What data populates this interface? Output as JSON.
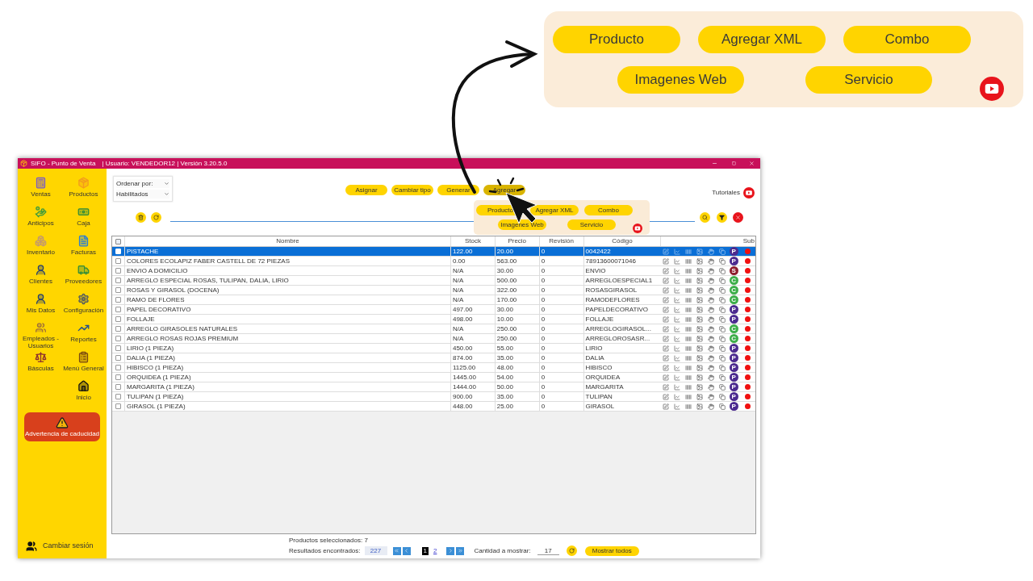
{
  "window": {
    "title": "SIFO - Punto de Venta",
    "info": "| Usuario: VENDEDOR12 | Versión 3.20.5.0"
  },
  "sidebar": {
    "items": [
      {
        "label": "Ventas",
        "kind": "register"
      },
      {
        "label": "Productos",
        "kind": "box"
      },
      {
        "label": "Anticipos",
        "kind": "money"
      },
      {
        "label": "Caja",
        "kind": "cash"
      },
      {
        "label": "Inventario",
        "kind": "boxes"
      },
      {
        "label": "Facturas",
        "kind": "document"
      },
      {
        "label": "Clientes",
        "kind": "person"
      },
      {
        "label": "Proveedores",
        "kind": "truck"
      },
      {
        "label": "Mis Datos",
        "kind": "person"
      },
      {
        "label": "Configuración",
        "kind": "gear"
      },
      {
        "label": "Empleados - Usuarios",
        "kind": "group"
      },
      {
        "label": "Reportes",
        "kind": "chart"
      },
      {
        "label": "Básculas",
        "kind": "scale"
      },
      {
        "label": "Menú General",
        "kind": "clipboard"
      },
      {
        "label": "Inicio",
        "kind": "home"
      }
    ],
    "warning": "Advertencia de caducidad",
    "session": "Cambiar sesión"
  },
  "filters": [
    "Ordenar por:",
    "Habilitados"
  ],
  "actions": [
    {
      "label": "Asignar",
      "selected": false
    },
    {
      "label": "Cambiar tipo",
      "selected": false
    },
    {
      "label": "Generar",
      "selected": false
    },
    {
      "label": "Agregar",
      "selected": true
    }
  ],
  "tutorials": "Tutoriales",
  "add_menu": [
    "Producto",
    "Agregar XML",
    "Combo",
    "Imagenes Web",
    "Servicio"
  ],
  "table": {
    "select_all": {
      "checked": false
    },
    "columns": [
      "Nombre",
      "Stock",
      "Precio",
      "Revisión",
      "Código"
    ],
    "sub_column": "Sub",
    "rows": [
      {
        "cells": [
          "PISTACHE",
          "122.00",
          "20.00",
          "0",
          "0042422"
        ],
        "badge": "P",
        "color": "#4b2a8f",
        "selected": true,
        "checked": false
      },
      {
        "cells": [
          "COLORES ECOLAPIZ FABER CASTELL DE 72 PIEZAS",
          "0.00",
          "563.00",
          "0",
          "78913600071046"
        ],
        "badge": "P",
        "color": "#4b2a8f",
        "selected": false,
        "checked": false
      },
      {
        "cells": [
          "ENVIO A DOMICILIO",
          "N/A",
          "30.00",
          "0",
          "ENVIO"
        ],
        "badge": "S",
        "color": "#8e1c2c",
        "selected": false,
        "checked": false
      },
      {
        "cells": [
          "ARREGLO ESPECIAL ROSAS, TULIPAN, DALIA, LIRIO",
          "N/A",
          "500.00",
          "0",
          "ARREGLOESPECIAL1"
        ],
        "badge": "C",
        "color": "#3dae49",
        "selected": false,
        "checked": false
      },
      {
        "cells": [
          "ROSAS Y GIRASOL (DOCENA)",
          "N/A",
          "322.00",
          "0",
          "ROSASGIRASOL"
        ],
        "badge": "C",
        "color": "#3dae49",
        "selected": false,
        "checked": false
      },
      {
        "cells": [
          "RAMO DE FLORES",
          "N/A",
          "170.00",
          "0",
          "RAMODEFLORES"
        ],
        "badge": "C",
        "color": "#3dae49",
        "selected": false,
        "checked": false
      },
      {
        "cells": [
          "PAPEL DECORATIVO",
          "497.00",
          "30.00",
          "0",
          "PAPELDECORATIVO"
        ],
        "badge": "P",
        "color": "#4b2a8f",
        "selected": false,
        "checked": false
      },
      {
        "cells": [
          "FOLLAJE",
          "498.00",
          "10.00",
          "0",
          "FOLLAJE"
        ],
        "badge": "P",
        "color": "#4b2a8f",
        "selected": false,
        "checked": false
      },
      {
        "cells": [
          "ARREGLO GIRASOLES NATURALES",
          "N/A",
          "250.00",
          "0",
          "ARREGLOGIRASOL..."
        ],
        "badge": "C",
        "color": "#3dae49",
        "selected": false,
        "checked": false
      },
      {
        "cells": [
          "ARREGLO ROSAS ROJAS PREMIUM",
          "N/A",
          "250.00",
          "0",
          "ARREGLOROSASR..."
        ],
        "badge": "C",
        "color": "#3dae49",
        "selected": false,
        "checked": false
      },
      {
        "cells": [
          "LIRIO (1 PIEZA)",
          "450.00",
          "55.00",
          "0",
          "LIRIO"
        ],
        "badge": "P",
        "color": "#4b2a8f",
        "selected": false,
        "checked": false
      },
      {
        "cells": [
          "DALIA (1 PIEZA)",
          "874.00",
          "35.00",
          "0",
          "DALIA"
        ],
        "badge": "P",
        "color": "#4b2a8f",
        "selected": false,
        "checked": false
      },
      {
        "cells": [
          "HIBISCO (1 PIEZA)",
          "1125.00",
          "48.00",
          "0",
          "HIBISCO"
        ],
        "badge": "P",
        "color": "#4b2a8f",
        "selected": false,
        "checked": false
      },
      {
        "cells": [
          "ORQUIDEA (1 PIEZA)",
          "1445.00",
          "54.00",
          "0",
          "ORQUIDEA"
        ],
        "badge": "P",
        "color": "#4b2a8f",
        "selected": false,
        "checked": false
      },
      {
        "cells": [
          "MARGARITA (1 PIEZA)",
          "1444.00",
          "50.00",
          "0",
          "MARGARITA"
        ],
        "badge": "P",
        "color": "#4b2a8f",
        "selected": false,
        "checked": false
      },
      {
        "cells": [
          "TULIPAN (1 PIEZA)",
          "900.00",
          "35.00",
          "0",
          "TULIPAN"
        ],
        "badge": "P",
        "color": "#4b2a8f",
        "selected": false,
        "checked": false
      },
      {
        "cells": [
          "GIRASOL (1 PIEZA)",
          "448.00",
          "25.00",
          "0",
          "GIRASOL"
        ],
        "badge": "P",
        "color": "#4b2a8f",
        "selected": false,
        "checked": false
      }
    ]
  },
  "footer": {
    "selected": "Productos seleccionados: 7",
    "results_label": "Resultados encontrados:",
    "results": "227",
    "pages": [
      {
        "label": "1",
        "selected": true
      },
      {
        "label": "2",
        "selected": false
      }
    ],
    "quantity_label": "Cantidad a mostrar:",
    "quantity": "17",
    "show_all": "Mostrar todos"
  },
  "callout": [
    "Producto",
    "Agregar XML",
    "Combo",
    "Imagenes Web",
    "Servicio"
  ]
}
